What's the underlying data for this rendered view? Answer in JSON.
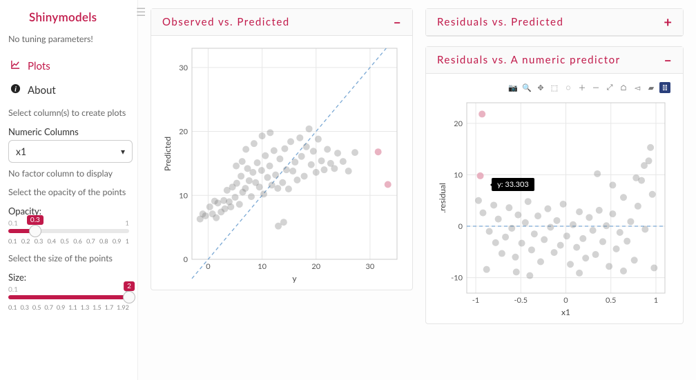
{
  "app": {
    "title": "Shinymodels",
    "subtitle": "No tuning parameters!"
  },
  "nav": {
    "plots": "Plots",
    "about": "About"
  },
  "sidebar": {
    "select_cols_hint": "Select column(s) to create plots",
    "numeric_label": "Numeric Columns",
    "numeric_value": "x1",
    "no_factor": "No factor column to display",
    "opacity_hint": "Select the opacity of the points",
    "opacity_label": "Opacity:",
    "opacity_min": "0.1",
    "opacity_max": "1",
    "opacity_value": "0.3",
    "opacity_ticks": [
      "0.1",
      "0.2",
      "0.3",
      "0.4",
      "0.5",
      "0.6",
      "0.7",
      "0.8",
      "0.9",
      "1"
    ],
    "size_hint": "Select the size of the points",
    "size_label": "Size:",
    "size_min": "0.1",
    "size_max": "2",
    "size_value": "2",
    "size_ticks": [
      "0.1",
      "0.3",
      "0.5",
      "0.7",
      "0.9",
      "1.1",
      "1.3",
      "1.5",
      "1.7",
      "1.92"
    ]
  },
  "panels": {
    "obs_pred": {
      "title": "Observed vs. Predicted",
      "toggle": "–"
    },
    "res_pred": {
      "title": "Residuals vs. Predicted",
      "toggle": "+"
    },
    "res_num": {
      "title": "Residuals vs. A numeric predictor",
      "toggle": "–"
    }
  },
  "tooltip": {
    "text": "y: 33.303"
  },
  "chart_data": [
    {
      "type": "scatter",
      "title": "Observed vs. Predicted",
      "xlabel": "y",
      "ylabel": "Predicted",
      "xlim": [
        -3,
        35
      ],
      "ylim": [
        0,
        33
      ],
      "xticks": [
        0,
        10,
        20,
        30
      ],
      "yticks": [
        0,
        10,
        20,
        30
      ],
      "ref_line": "y=x",
      "series": [
        {
          "name": "points",
          "values": [
            [
              -1.5,
              6.3
            ],
            [
              -1,
              7.1
            ],
            [
              -0.5,
              6.8
            ],
            [
              0.3,
              8.2
            ],
            [
              0.8,
              7.1
            ],
            [
              1.2,
              9.1
            ],
            [
              1.5,
              6.5
            ],
            [
              1.8,
              8.8
            ],
            [
              2.4,
              7.4
            ],
            [
              2.9,
              9.2
            ],
            [
              3.1,
              7.9
            ],
            [
              3.5,
              10.8
            ],
            [
              3.9,
              9.0
            ],
            [
              4.2,
              8.2
            ],
            [
              4.5,
              11.3
            ],
            [
              5.0,
              9.7
            ],
            [
              5.3,
              11.9
            ],
            [
              5.8,
              8.6
            ],
            [
              6.1,
              13.0
            ],
            [
              6.4,
              10.5
            ],
            [
              6.9,
              11.1
            ],
            [
              7.3,
              14.2
            ],
            [
              7.6,
              12.3
            ],
            [
              8.0,
              9.8
            ],
            [
              8.3,
              13.6
            ],
            [
              8.8,
              12.0
            ],
            [
              9.1,
              15.1
            ],
            [
              9.5,
              11.3
            ],
            [
              9.9,
              13.9
            ],
            [
              10.3,
              10.2
            ],
            [
              10.6,
              16.2
            ],
            [
              11.0,
              12.8
            ],
            [
              11.4,
              14.6
            ],
            [
              11.8,
              11.6
            ],
            [
              12.2,
              17.0
            ],
            [
              12.5,
              13.2
            ],
            [
              12.9,
              11.1
            ],
            [
              13.3,
              15.7
            ],
            [
              13.8,
              12.0
            ],
            [
              14.2,
              17.3
            ],
            [
              14.5,
              14.0
            ],
            [
              14.9,
              11.0
            ],
            [
              15.3,
              18.4
            ],
            [
              15.7,
              13.8
            ],
            [
              16.1,
              15.2
            ],
            [
              16.5,
              12.4
            ],
            [
              17.0,
              19.0
            ],
            [
              17.3,
              16.1
            ],
            [
              17.8,
              13.0
            ],
            [
              18.2,
              17.6
            ],
            [
              18.7,
              20.4
            ],
            [
              19.1,
              14.8
            ],
            [
              19.5,
              16.9
            ],
            [
              20.0,
              13.6
            ],
            [
              20.4,
              18.8
            ],
            [
              21.0,
              15.4
            ],
            [
              21.5,
              14.0
            ],
            [
              22.1,
              17.2
            ],
            [
              22.7,
              15.0
            ],
            [
              23.4,
              14.2
            ],
            [
              24.0,
              16.6
            ],
            [
              25.0,
              15.3
            ],
            [
              26.0,
              13.8
            ],
            [
              27.2,
              16.7
            ],
            [
              13.0,
              5.2
            ],
            [
              14.0,
              5.8
            ],
            [
              7.0,
              17.2
            ],
            [
              8.5,
              18.1
            ],
            [
              10.0,
              19.3
            ],
            [
              11.5,
              19.8
            ],
            [
              5.2,
              14.6
            ],
            [
              6.3,
              15.3
            ]
          ]
        },
        {
          "name": "highlight",
          "values": [
            [
              31.5,
              16.8
            ],
            [
              33.3,
              11.7
            ]
          ]
        }
      ]
    },
    {
      "type": "scatter",
      "title": "Residuals vs. A numeric predictor",
      "xlabel": "x1",
      "ylabel": ".residual",
      "xlim": [
        -1.1,
        1.1
      ],
      "ylim": [
        -13,
        24
      ],
      "xticks": [
        -1.0,
        -0.5,
        0.0,
        0.5,
        1.0
      ],
      "yticks": [
        -10,
        0,
        10,
        20
      ],
      "ref_line": "y=0",
      "series": [
        {
          "name": "points",
          "values": [
            [
              -0.97,
              5.0
            ],
            [
              -0.92,
              2.6
            ],
            [
              -0.88,
              -8.4
            ],
            [
              -0.85,
              -1.0
            ],
            [
              -0.8,
              4.1
            ],
            [
              -0.78,
              -3.2
            ],
            [
              -0.75,
              1.4
            ],
            [
              -0.71,
              -5.3
            ],
            [
              -0.67,
              -2.1
            ],
            [
              -0.63,
              3.6
            ],
            [
              -0.6,
              -0.4
            ],
            [
              -0.56,
              -6.0
            ],
            [
              -0.53,
              2.2
            ],
            [
              -0.49,
              -3.3
            ],
            [
              -0.45,
              0.7
            ],
            [
              -0.42,
              4.8
            ],
            [
              -0.38,
              -4.6
            ],
            [
              -0.35,
              -1.5
            ],
            [
              -0.31,
              2.0
            ],
            [
              -0.28,
              -6.9
            ],
            [
              -0.24,
              -2.6
            ],
            [
              -0.2,
              3.4
            ],
            [
              -0.17,
              -0.2
            ],
            [
              -0.13,
              -5.1
            ],
            [
              -0.1,
              1.1
            ],
            [
              -0.06,
              -3.7
            ],
            [
              -0.03,
              4.3
            ],
            [
              0.01,
              -1.9
            ],
            [
              0.05,
              -7.4
            ],
            [
              0.08,
              0.3
            ],
            [
              0.12,
              -4.1
            ],
            [
              0.15,
              2.8
            ],
            [
              0.19,
              -2.4
            ],
            [
              0.22,
              -6.2
            ],
            [
              0.26,
              1.7
            ],
            [
              0.3,
              -0.8
            ],
            [
              0.33,
              -5.5
            ],
            [
              0.37,
              3.1
            ],
            [
              0.41,
              -3.0
            ],
            [
              0.45,
              0.1
            ],
            [
              0.48,
              -7.8
            ],
            [
              0.52,
              2.4
            ],
            [
              0.56,
              -4.4
            ],
            [
              0.6,
              -1.2
            ],
            [
              0.64,
              5.6
            ],
            [
              0.68,
              -2.9
            ],
            [
              0.72,
              0.9
            ],
            [
              0.76,
              -6.6
            ],
            [
              0.8,
              3.9
            ],
            [
              0.84,
              8.9
            ],
            [
              0.88,
              -0.6
            ],
            [
              0.92,
              12.7
            ],
            [
              0.94,
              15.3
            ],
            [
              0.96,
              6.2
            ],
            [
              0.98,
              -8.1
            ],
            [
              0.87,
              11.8
            ],
            [
              0.78,
              9.4
            ],
            [
              0.35,
              10.2
            ],
            [
              0.52,
              8.0
            ],
            [
              -0.55,
              -8.9
            ],
            [
              -0.4,
              -9.6
            ],
            [
              0.15,
              -9.1
            ],
            [
              0.64,
              -8.7
            ]
          ]
        },
        {
          "name": "highlight",
          "values": [
            [
              -0.93,
              21.8
            ],
            [
              -0.95,
              9.8
            ]
          ]
        }
      ],
      "tooltip_point": {
        "x": -0.9,
        "y": 8.0,
        "label": "y: 33.303"
      }
    }
  ]
}
